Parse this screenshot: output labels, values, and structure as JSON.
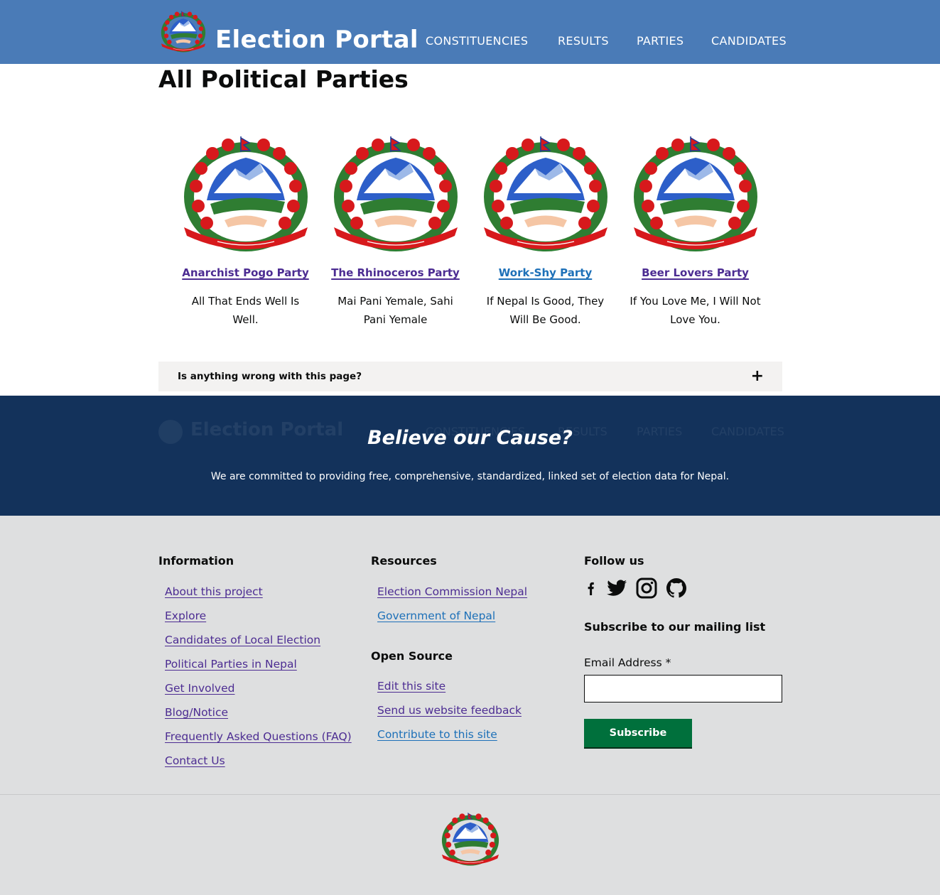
{
  "header": {
    "site_title": "Election Portal",
    "nav": [
      "CONSTITUENCIES",
      "RESULTS",
      "PARTIES",
      "CANDIDATES"
    ]
  },
  "page_title": "All Political Parties",
  "parties": [
    {
      "name": "Anarchist Pogo Party",
      "slogan": "All That Ends Well Is Well."
    },
    {
      "name": "The Rhinoceros Party",
      "slogan": "Mai Pani Yemale, Sahi Pani Yemale"
    },
    {
      "name": "Work-Shy Party",
      "slogan": "If Nepal Is Good, They Will Be Good."
    },
    {
      "name": "Beer Lovers Party",
      "slogan": "If You Love Me, I Will Not Love You."
    }
  ],
  "feedback": {
    "question": "Is anything wrong with this page?",
    "toggle": "+"
  },
  "cause": {
    "title": "Believe our Cause?",
    "text": "We are committed to providing free, comprehensive, standardized, linked set of election data for Nepal."
  },
  "footer": {
    "information": {
      "heading": "Information",
      "links": [
        "About this project",
        "Explore",
        "Candidates of Local Election",
        "Political Parties in Nepal",
        "Get Involved",
        "Blog/Notice",
        "Frequently Asked Questions (FAQ)",
        "Contact Us"
      ]
    },
    "resources": {
      "heading": "Resources",
      "links": [
        "Election Commission Nepal",
        "Government of Nepal"
      ]
    },
    "open_source": {
      "heading": "Open Source",
      "links": [
        "Edit this site",
        "Send us website feedback",
        "Contribute to this site"
      ]
    },
    "follow": {
      "heading": "Follow us",
      "icons": [
        "facebook-icon",
        "twitter-icon",
        "instagram-icon",
        "github-icon"
      ]
    },
    "mailing": {
      "heading": "Subscribe to our mailing list",
      "email_label": "Email Address *",
      "email_value": "",
      "button": "Subscribe"
    }
  },
  "colors": {
    "header_bg": "#4a7bb7",
    "cause_bg": "#13325b",
    "footer_bg": "#dedfe0",
    "link_visited": "#4c2c92",
    "link": "#1d70b8",
    "button_green": "#00703c"
  }
}
